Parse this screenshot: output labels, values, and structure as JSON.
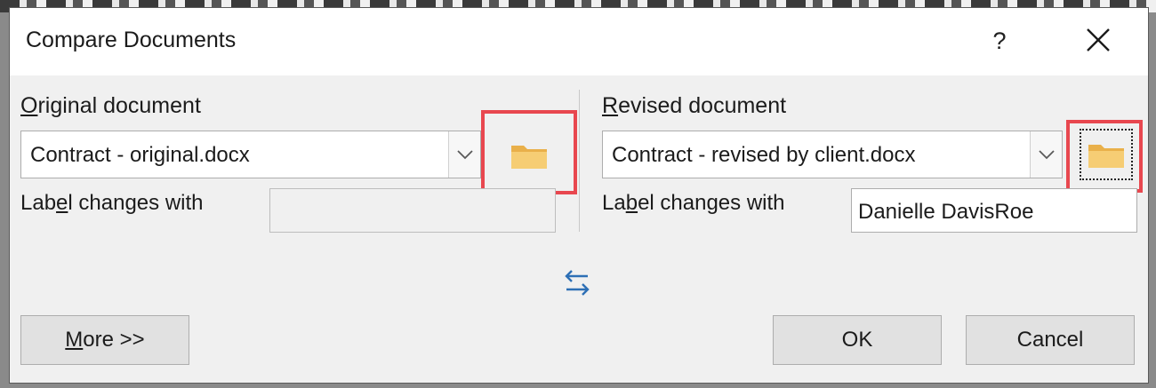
{
  "dialog": {
    "title": "Compare Documents",
    "help_label": "?",
    "close_icon": "close-icon"
  },
  "original": {
    "label_accel": "O",
    "label_rest": "riginal document",
    "file_value": "Contract - original.docx",
    "label_changes_pre": "Lab",
    "label_changes_accel": "e",
    "label_changes_post": "l changes with",
    "label_changes_value": ""
  },
  "revised": {
    "label_accel": "R",
    "label_rest": "evised document",
    "file_value": "Contract - revised by client.docx",
    "label_changes_pre": "La",
    "label_changes_accel": "b",
    "label_changes_post": "el changes with",
    "label_changes_value": "Danielle DavisRoe"
  },
  "buttons": {
    "more_accel": "M",
    "more_rest": "ore >>",
    "ok": "OK",
    "cancel": "Cancel"
  },
  "icons": {
    "folder": "folder-icon",
    "swap": "swap-arrows-icon",
    "dropdown": "chevron-down-icon"
  },
  "colors": {
    "highlight": "#e8474f",
    "folder": "#f3c363",
    "swap": "#2d6fb5"
  }
}
